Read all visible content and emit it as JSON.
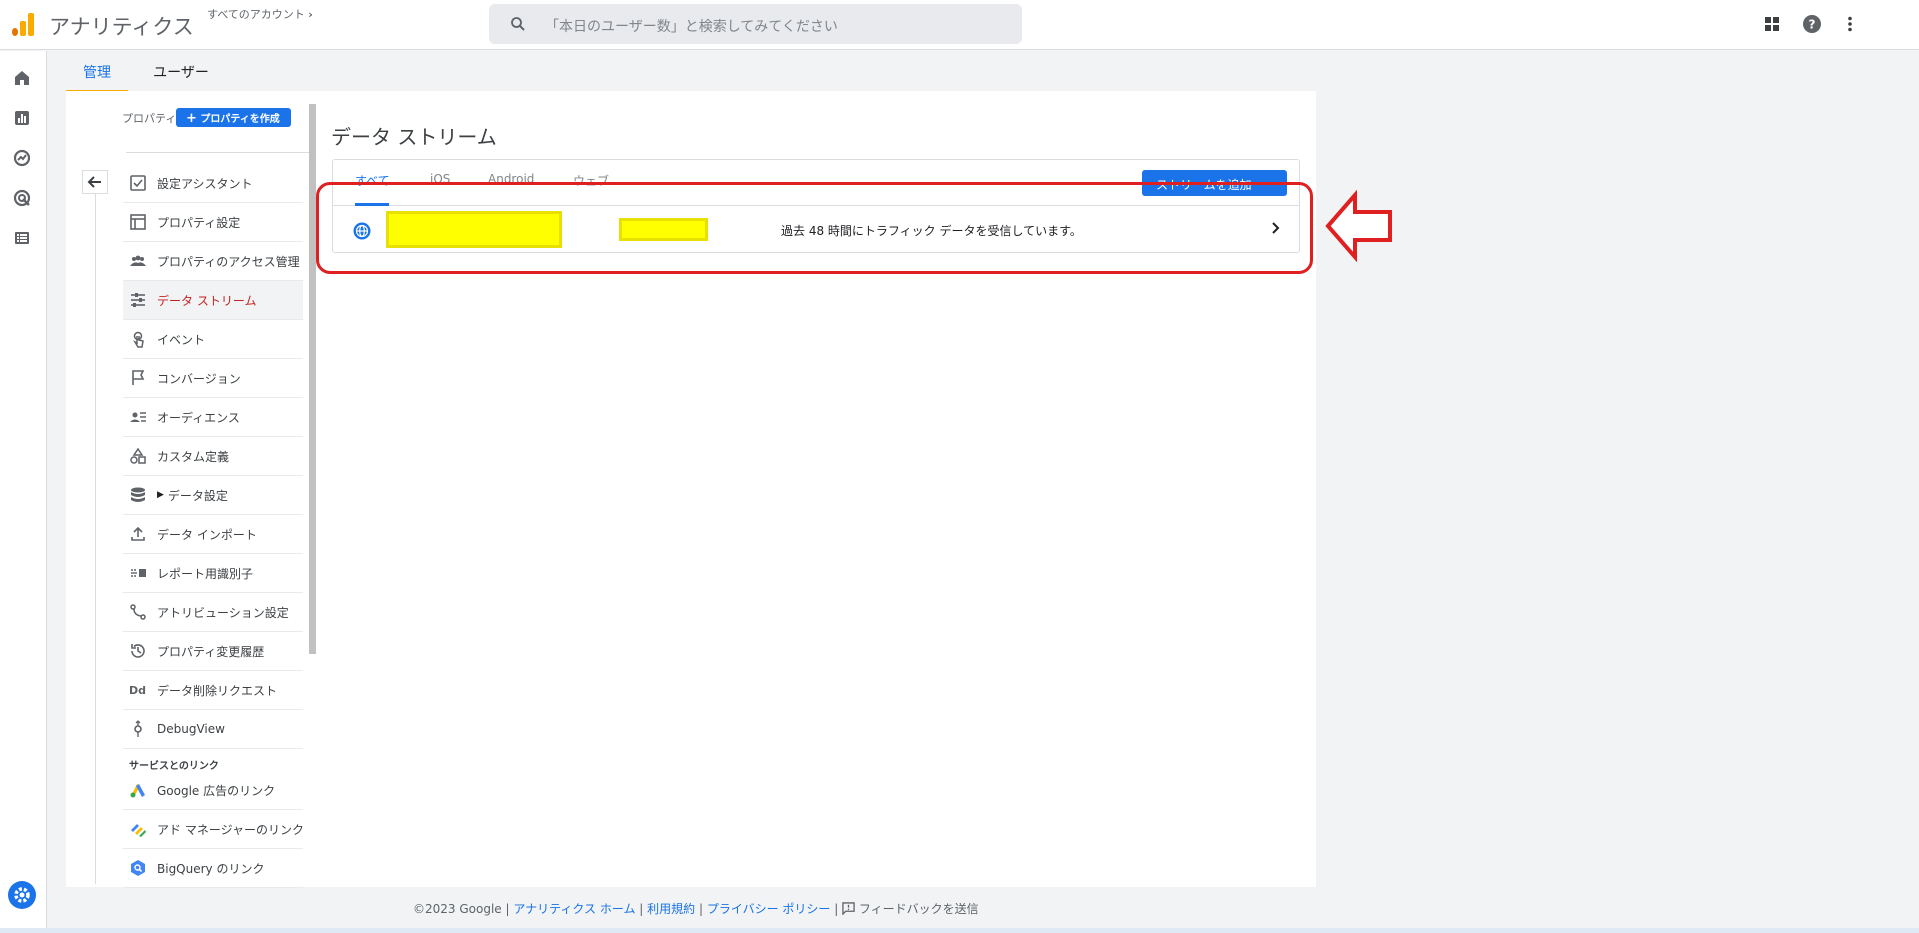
{
  "header": {
    "app_title": "アナリティクス",
    "account_link": "すべてのアカウント",
    "search_placeholder": "「本日のユーザー数」と検索してみてください"
  },
  "admin_tabs": [
    {
      "label": "管理",
      "active": true
    },
    {
      "label": "ユーザー",
      "active": false
    }
  ],
  "property": {
    "label": "プロパティ",
    "create_button": "プロパティを作成"
  },
  "nav": {
    "items": [
      {
        "label": "設定アシスタント",
        "icon": "checkbox-icon"
      },
      {
        "label": "プロパティ設定",
        "icon": "property-settings-icon"
      },
      {
        "label": "プロパティのアクセス管理",
        "icon": "people-icon"
      },
      {
        "label": "データ ストリーム",
        "icon": "data-stream-icon",
        "active": true
      },
      {
        "label": "イベント",
        "icon": "touch-icon"
      },
      {
        "label": "コンバージョン",
        "icon": "flag-icon"
      },
      {
        "label": "オーディエンス",
        "icon": "audience-icon"
      },
      {
        "label": "カスタム定義",
        "icon": "shapes-icon"
      },
      {
        "label": "データ設定",
        "icon": "database-icon"
      },
      {
        "label": "データ インポート",
        "icon": "upload-icon"
      },
      {
        "label": "レポート用識別子",
        "icon": "identity-icon"
      },
      {
        "label": "アトリビューション設定",
        "icon": "attribution-icon"
      },
      {
        "label": "プロパティ変更履歴",
        "icon": "history-icon"
      },
      {
        "label": "データ削除リクエスト",
        "icon": "dd-icon"
      },
      {
        "label": "DebugView",
        "icon": "debug-icon"
      }
    ],
    "links_header": "サービスとのリンク",
    "links": [
      {
        "label": "Google 広告のリンク",
        "icon": "google-ads-icon"
      },
      {
        "label": "アド マネージャーのリンク",
        "icon": "ad-manager-icon"
      },
      {
        "label": "BigQuery のリンク",
        "icon": "bigquery-icon"
      }
    ]
  },
  "content": {
    "title": "データ ストリーム",
    "tabs": [
      "すべて",
      "iOS",
      "Android",
      "ウェブ"
    ],
    "add_button": "ストリームを追加",
    "row_status": "過去 48 時間にトラフィック データを受信しています。"
  },
  "footer": {
    "copyright": "©2023 Google",
    "links": [
      "アナリティクス ホーム",
      "利用規約",
      "プライバシー ポリシー"
    ],
    "feedback": "フィードバックを送信"
  },
  "colors": {
    "accent": "#1a73e8",
    "brand": "#f9ab00",
    "annotation_red": "#e02020",
    "redaction_yellow": "#ffff00"
  }
}
